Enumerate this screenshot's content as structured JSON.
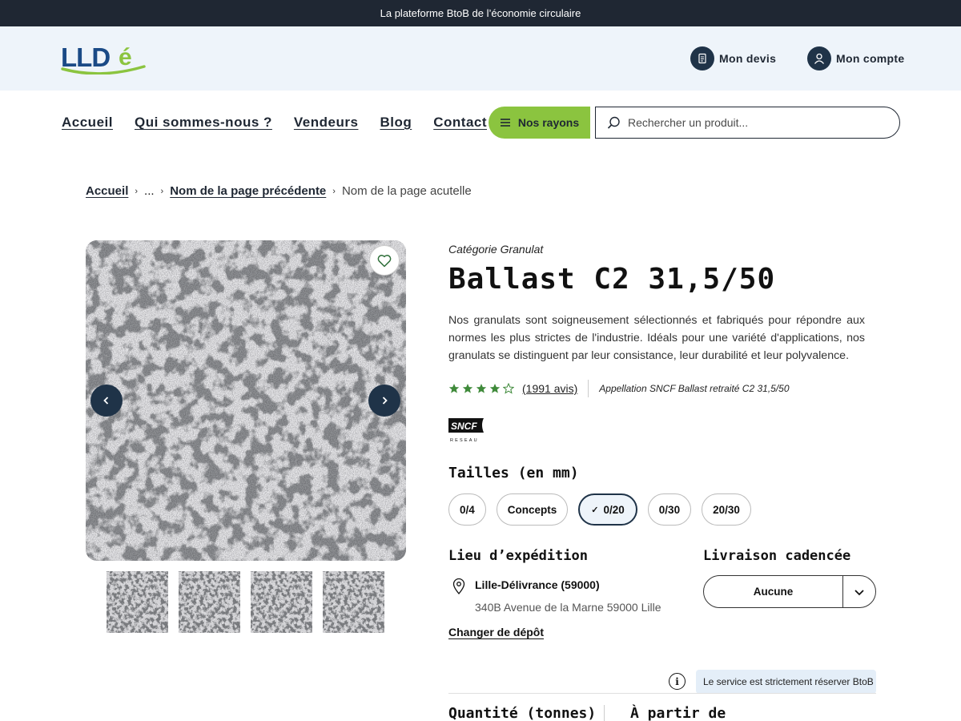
{
  "topbar": {
    "text": "La plateforme BtoB de l’économie circulaire"
  },
  "header": {
    "logo_text": "LLDé",
    "devis_label": "Mon devis",
    "compte_label": "Mon compte"
  },
  "nav": {
    "items": [
      "Accueil",
      "Qui sommes-nous ?",
      "Vendeurs",
      "Blog",
      "Contact"
    ],
    "rayons_label": "Nos rayons",
    "search_placeholder": "Rechercher un produit..."
  },
  "breadcrumb": {
    "home": "Accueil",
    "ellipsis": "...",
    "previous": "Nom de la page précédente",
    "current": "Nom de la page acutelle"
  },
  "product": {
    "category": "Catégorie Granulat",
    "title": "Ballast C2 31,5/50",
    "description": "Nos granulats sont soigneusement sélectionnés et fabriqués pour répondre aux normes les plus strictes de l'industrie. Idéals pour une variété d'applications, nos granulats se distinguent par leur consistance, leur durabilité et leur polyvalence.",
    "rating": 4,
    "rating_max": 5,
    "reviews": "(1991 avis)",
    "appellation": "Appellation SNCF Ballast retraité C2 31,5/50",
    "brand_logo": {
      "main": "SNCF",
      "sub": "RESEAU"
    }
  },
  "sizes": {
    "heading": "Tailles (en mm)",
    "options": [
      "0/4",
      "Concepts",
      "0/20",
      "0/30",
      "20/30"
    ],
    "selected": "0/20",
    "check": "✓"
  },
  "shipping": {
    "heading": "Lieu d’expédition",
    "depot_name": "Lille-Délivrance (59000)",
    "depot_address": "340B Avenue de la Marne 59000 Lille",
    "change_label": "Changer de dépôt"
  },
  "delivery": {
    "heading": "Livraison cadencée",
    "selected": "Aucune"
  },
  "info": {
    "icon_text": "i",
    "tooltip": "Le service est strictement réserver BtoB"
  },
  "bottom": {
    "quantity_heading": "Quantité (tonnes)",
    "price_heading": "À partir de"
  },
  "colors": {
    "dark": "#1f2733",
    "navy": "#1f3348",
    "green": "#8bc43f",
    "star_green": "#3f8a3a",
    "header_bg": "#eef4fa"
  },
  "icons": [
    "heart-icon",
    "chevron-left-icon",
    "chevron-right-icon",
    "search-icon",
    "menu-icon",
    "document-icon",
    "user-icon",
    "star-icon",
    "location-pin-icon",
    "chevron-down-icon",
    "info-icon"
  ]
}
